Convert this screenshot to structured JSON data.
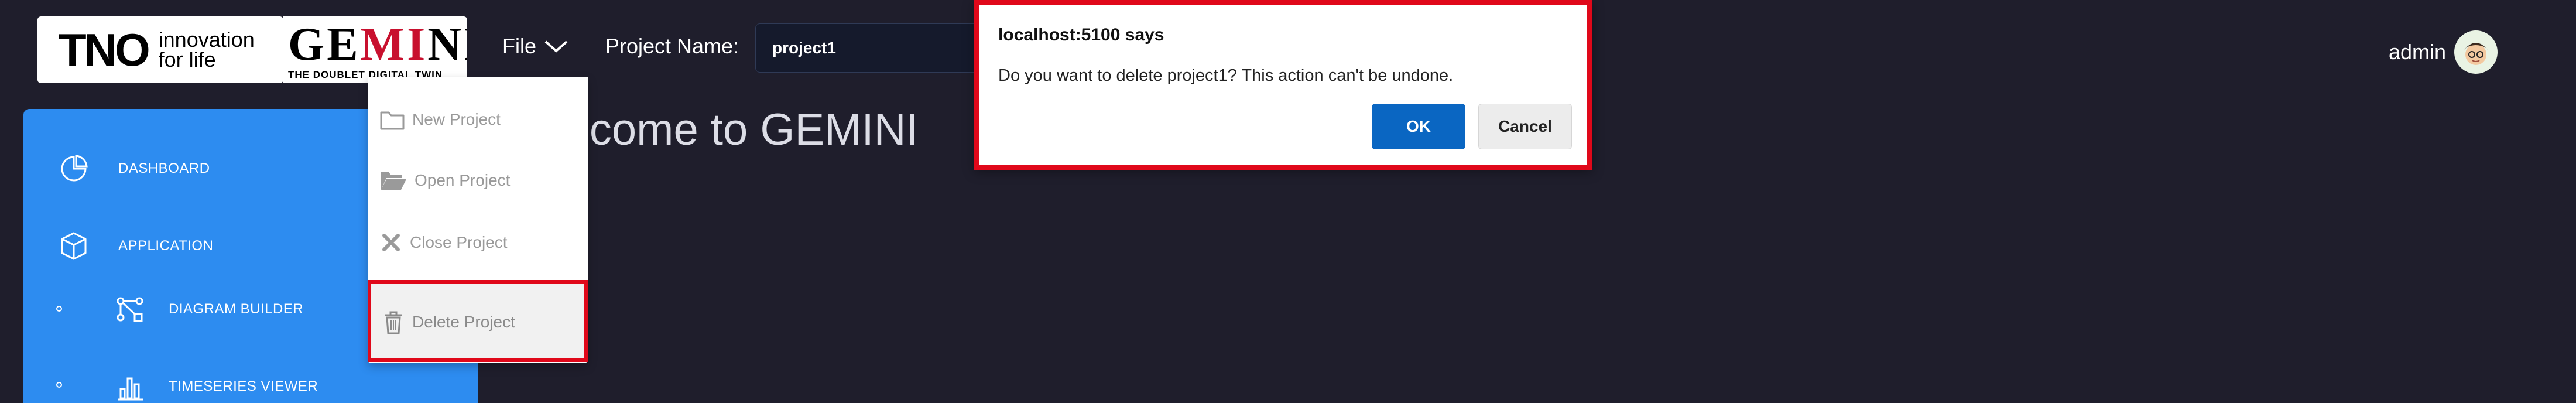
{
  "header": {
    "tno_logo": "TNO",
    "tno_tagline_line1": "innovation",
    "tno_tagline_line2": "for life",
    "gemini_logo_part1": "GE",
    "gemini_logo_part2": "MI",
    "gemini_logo_part3": "NI",
    "gemini_tagline": "THE DOUBLET DIGITAL TWIN",
    "file_menu_label": "File",
    "project_name_label": "Project Name:",
    "project_name_value": "project1",
    "user_name": "admin"
  },
  "sidebar": {
    "items": [
      {
        "label": "DASHBOARD",
        "icon": "pie-chart-icon"
      },
      {
        "label": "APPLICATION",
        "icon": "cube-icon"
      },
      {
        "label": "DIAGRAM BUILDER",
        "icon": "diagram-icon"
      },
      {
        "label": "TIMESERIES VIEWER",
        "icon": "bar-chart-icon"
      }
    ]
  },
  "main": {
    "welcome_text": "lcome to GEMINI"
  },
  "file_dropdown": {
    "items": [
      {
        "label": "New Project",
        "icon": "folder-icon"
      },
      {
        "label": "Open Project",
        "icon": "folder-open-icon"
      },
      {
        "label": "Close Project",
        "icon": "close-x-icon"
      },
      {
        "label": "Delete Project",
        "icon": "trash-icon"
      }
    ]
  },
  "dialog": {
    "title": "localhost:5100 says",
    "message": "Do you want to delete project1? This action can't be undone.",
    "ok_label": "OK",
    "cancel_label": "Cancel"
  },
  "colors": {
    "page_background": "#1f1e2c",
    "sidebar_accent": "#2d8cf0",
    "highlight_red": "#e0081a",
    "ok_button": "#0a66c2"
  }
}
